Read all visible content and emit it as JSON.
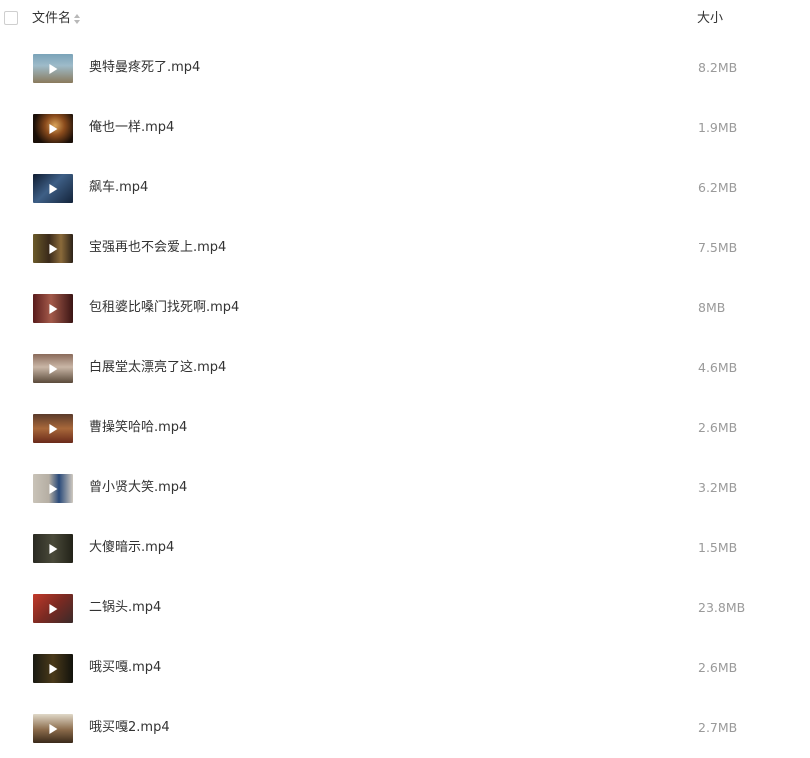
{
  "header": {
    "name_label": "文件名",
    "size_label": "大小"
  },
  "files": [
    {
      "name": "奥特曼疼死了.mp4",
      "size": "8.2MB",
      "thumb": "linear-gradient(180deg,#7aa3b8 0%,#9ebbc9 40%,#8a7a5c 100%)"
    },
    {
      "name": "俺也一样.mp4",
      "size": "1.9MB",
      "thumb": "radial-gradient(circle at 55% 40%,#d9a45a 0%,#8a4b1c 35%,#1a0f08 75%)"
    },
    {
      "name": "飙车.mp4",
      "size": "6.2MB",
      "thumb": "linear-gradient(135deg,#0f1c30 0%,#3e5f86 45%,#13233a 100%)"
    },
    {
      "name": "宝强再也不会爱上.mp4",
      "size": "7.5MB",
      "thumb": "linear-gradient(90deg,#6b5a2a 0%,#3a2a1a 40%,#8a6a3a 70%,#2c2218 100%)"
    },
    {
      "name": "包租婆比嗓门找死啊.mp4",
      "size": "8MB",
      "thumb": "linear-gradient(90deg,#5a1c1c 0%,#a35a4a 45%,#3a1414 100%)"
    },
    {
      "name": "白展堂太漂亮了这.mp4",
      "size": "4.6MB",
      "thumb": "linear-gradient(180deg,#8a6a5a 0%,#c9b6a6 45%,#5a4a3a 100%)"
    },
    {
      "name": "曹操笑哈哈.mp4",
      "size": "2.6MB",
      "thumb": "linear-gradient(180deg,#5a3a2a 0%,#a8683a 50%,#6a2a1a 100%)"
    },
    {
      "name": "曾小贤大笑.mp4",
      "size": "3.2MB",
      "thumb": "linear-gradient(90deg,#c9c3b8 0%,#b5aea3 40%,#2a4a7a 65%,#cfc9bf 100%)"
    },
    {
      "name": "大傻暗示.mp4",
      "size": "1.5MB",
      "thumb": "linear-gradient(90deg,#2a2a22 0%,#4a4a3a 50%,#222218 100%)"
    },
    {
      "name": "二锅头.mp4",
      "size": "23.8MB",
      "thumb": "linear-gradient(135deg,#c23a2a 0%,#7a2a22 50%,#3a2a2a 100%)"
    },
    {
      "name": "哦买嘎.mp4",
      "size": "2.6MB",
      "thumb": "linear-gradient(90deg,#1a1a12 0%,#4a3a1a 50%,#12120c 100%)"
    },
    {
      "name": "哦买嘎2.mp4",
      "size": "2.7MB",
      "thumb": "linear-gradient(180deg,#e0d8c8 0%,#8a6a4a 55%,#3a2a1a 100%)"
    }
  ]
}
